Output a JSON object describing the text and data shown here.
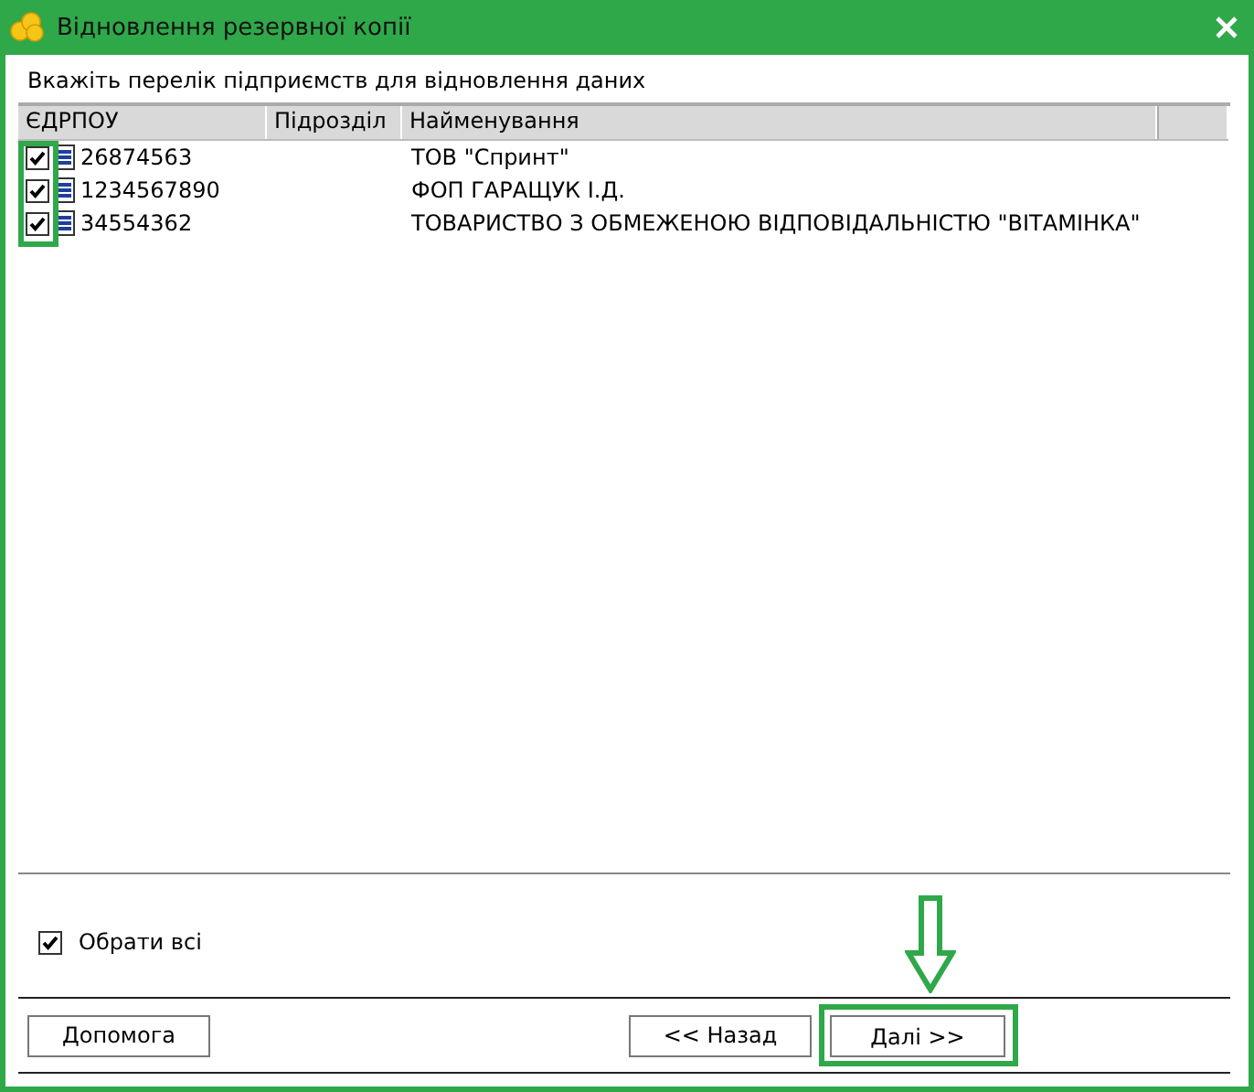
{
  "window": {
    "title": "Відновлення резервної копії"
  },
  "instruction": "Вкажіть перелік підприємств для відновлення даних",
  "table": {
    "columns": [
      "ЄДРПОУ",
      "Підрозділ",
      "Найменування"
    ],
    "checkbox_column_highlighted": true,
    "rows": [
      {
        "checked": true,
        "code": "26874563",
        "name": "ТОВ \"Спринт\""
      },
      {
        "checked": true,
        "code": "1234567890",
        "name": "ФОП ГАРАЩУК І.Д."
      },
      {
        "checked": true,
        "code": "34554362",
        "name": "ТОВАРИСТВО З ОБМЕЖЕНОЮ ВІДПОВІДАЛЬНІСТЮ \"ВІТАМІНКА\""
      }
    ]
  },
  "select_all": {
    "label": "Обрати всі",
    "checked": true
  },
  "buttons": [
    {
      "kind": "help",
      "label": "Допомога",
      "highlighted": false
    },
    {
      "kind": "back",
      "label": "<< Назад",
      "highlighted": false
    },
    {
      "kind": "next",
      "label": "Далі >>",
      "highlighted": true
    }
  ]
}
